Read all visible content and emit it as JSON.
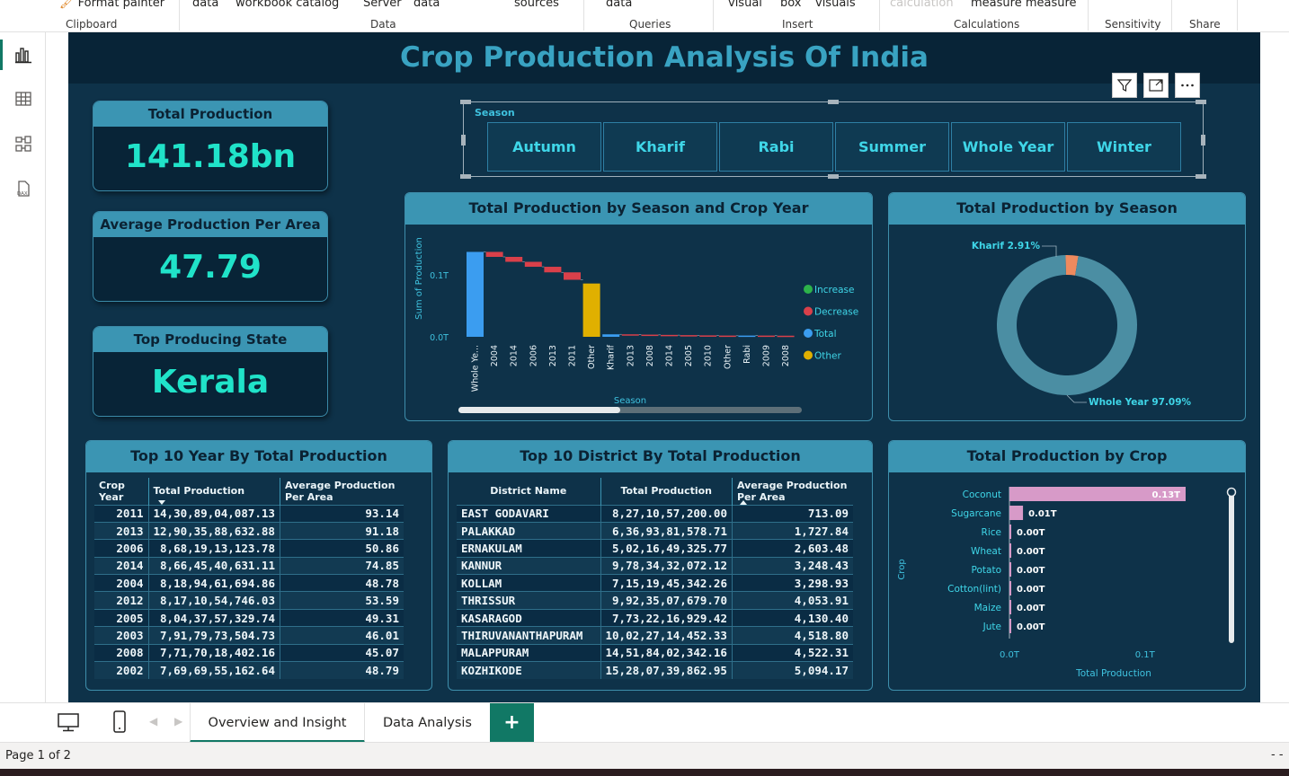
{
  "ribbon": {
    "top_items": [
      "Format painter",
      "data",
      "workbook catalog",
      "Server",
      "data",
      "sources",
      "data",
      "visual",
      "box",
      "visuals",
      "calculation",
      "measure measure"
    ],
    "groups": [
      "Clipboard",
      "Data",
      "Queries",
      "Insert",
      "Calculations",
      "Sensitivity",
      "Share"
    ]
  },
  "report": {
    "title": "Crop Production Analysis Of India"
  },
  "kpis": [
    {
      "label": "Total Production",
      "value": "141.18bn"
    },
    {
      "label": "Average Production Per Area",
      "value": "47.79"
    },
    {
      "label": "Top Producing State",
      "value": "Kerala"
    }
  ],
  "slicer": {
    "label": "Season",
    "options": [
      "Autumn",
      "Kharif",
      "Rabi",
      "Summer",
      "Whole Year",
      "Winter"
    ]
  },
  "waterfall": {
    "title": "Total Production by Season and Crop Year",
    "ylabel": "Sum of Production",
    "xlabel": "Season",
    "legend": [
      {
        "name": "Increase",
        "color": "#2db34a"
      },
      {
        "name": "Decrease",
        "color": "#d9404a"
      },
      {
        "name": "Total",
        "color": "#3b9df0"
      },
      {
        "name": "Other",
        "color": "#e0b000"
      }
    ]
  },
  "donut_meta": {
    "title": "Total Production by Season"
  },
  "crop_meta": {
    "title": "Total Production by Crop",
    "ylabel": "Crop",
    "xlabel": "Total Production"
  },
  "chart_data": [
    {
      "type": "bar",
      "subtype": "waterfall",
      "ylabel": "Sum of Production",
      "xlabel": "Season",
      "yticks": [
        "0.1T",
        "0.0T"
      ],
      "ylim": [
        0,
        0.14
      ],
      "categories": [
        "Whole Ye...",
        "2004",
        "2014",
        "2006",
        "2013",
        "2011",
        "Other",
        "Kharif",
        "2013",
        "2008",
        "2014",
        "2005",
        "2010",
        "Other",
        "Rabi",
        "2009",
        "2008"
      ],
      "kinds": [
        "total",
        "decrease",
        "decrease",
        "decrease",
        "decrease",
        "decrease",
        "other",
        "total",
        "decrease",
        "decrease",
        "decrease",
        "decrease",
        "decrease",
        "decrease",
        "total",
        "decrease",
        "decrease"
      ],
      "values": [
        0.137,
        -0.008,
        -0.008,
        -0.008,
        -0.009,
        -0.012,
        0.086,
        0.004,
        -0.0005,
        -0.0004,
        -0.0004,
        -0.0004,
        -0.0003,
        -0.0003,
        0.002,
        -0.0002,
        -0.0002
      ]
    },
    {
      "type": "pie",
      "subtype": "donut",
      "slices": [
        {
          "label": "Whole Year",
          "value": 97.09,
          "display": "Whole Year 97.09%",
          "color": "#4b8ea3"
        },
        {
          "label": "Kharif",
          "value": 2.91,
          "display": "Kharif 2.91%",
          "color": "#ee8a5e"
        }
      ]
    },
    {
      "type": "bar",
      "orientation": "horizontal",
      "categories": [
        "Coconut",
        "Sugarcane",
        "Rice",
        "Wheat",
        "Potato",
        "Cotton(lint)",
        "Maize",
        "Jute"
      ],
      "values": [
        0.13,
        0.01,
        0.0,
        0.0,
        0.0,
        0.0,
        0.0,
        0.0
      ],
      "labels": [
        "0.13T",
        "0.01T",
        "0.00T",
        "0.00T",
        "0.00T",
        "0.00T",
        "0.00T",
        "0.00T"
      ],
      "xticks": [
        "0.0T",
        "0.1T"
      ],
      "xlim": [
        0,
        0.13
      ],
      "color": "#d79ac8"
    }
  ],
  "top_years": {
    "title": "Top 10 Year By Total Production",
    "columns": [
      "Crop Year",
      "Total Production",
      "Average Production Per Area"
    ],
    "rows": [
      [
        "2011",
        "14,30,89,04,087.13",
        "93.14"
      ],
      [
        "2013",
        "12,90,35,88,632.88",
        "91.18"
      ],
      [
        "2006",
        "8,68,19,13,123.78",
        "50.86"
      ],
      [
        "2014",
        "8,66,45,40,631.11",
        "74.85"
      ],
      [
        "2004",
        "8,18,94,61,694.86",
        "48.78"
      ],
      [
        "2012",
        "8,17,10,54,746.03",
        "53.59"
      ],
      [
        "2005",
        "8,04,37,57,329.74",
        "49.31"
      ],
      [
        "2003",
        "7,91,79,73,504.73",
        "46.01"
      ],
      [
        "2008",
        "7,71,70,18,402.16",
        "45.07"
      ],
      [
        "2002",
        "7,69,69,55,162.64",
        "48.79"
      ]
    ]
  },
  "top_districts": {
    "title": "Top 10 District By Total Production",
    "columns": [
      "District Name",
      "Total Production",
      "Average Production Per Area"
    ],
    "rows": [
      [
        "EAST GODAVARI",
        "8,27,10,57,200.00",
        "713.09"
      ],
      [
        "PALAKKAD",
        "6,36,93,81,578.71",
        "1,727.84"
      ],
      [
        "ERNAKULAM",
        "5,02,16,49,325.77",
        "2,603.48"
      ],
      [
        "KANNUR",
        "9,78,34,32,072.12",
        "3,248.43"
      ],
      [
        "KOLLAM",
        "7,15,19,45,342.26",
        "3,298.93"
      ],
      [
        "THRISSUR",
        "9,92,35,07,679.70",
        "4,053.91"
      ],
      [
        "KASARAGOD",
        "7,73,22,16,929.42",
        "4,130.40"
      ],
      [
        "THIRUVANANTHAPURAM",
        "10,02,27,14,452.33",
        "4,518.80"
      ],
      [
        "MALAPPURAM",
        "14,51,84,02,342.16",
        "4,522.31"
      ],
      [
        "KOZHIKODE",
        "15,28,07,39,862.95",
        "5,094.17"
      ]
    ]
  },
  "page_tabs": [
    "Overview and Insight",
    "Data Analysis"
  ],
  "add_page_label": "+",
  "status": {
    "page": "Page 1 of 2",
    "right": "- -"
  }
}
